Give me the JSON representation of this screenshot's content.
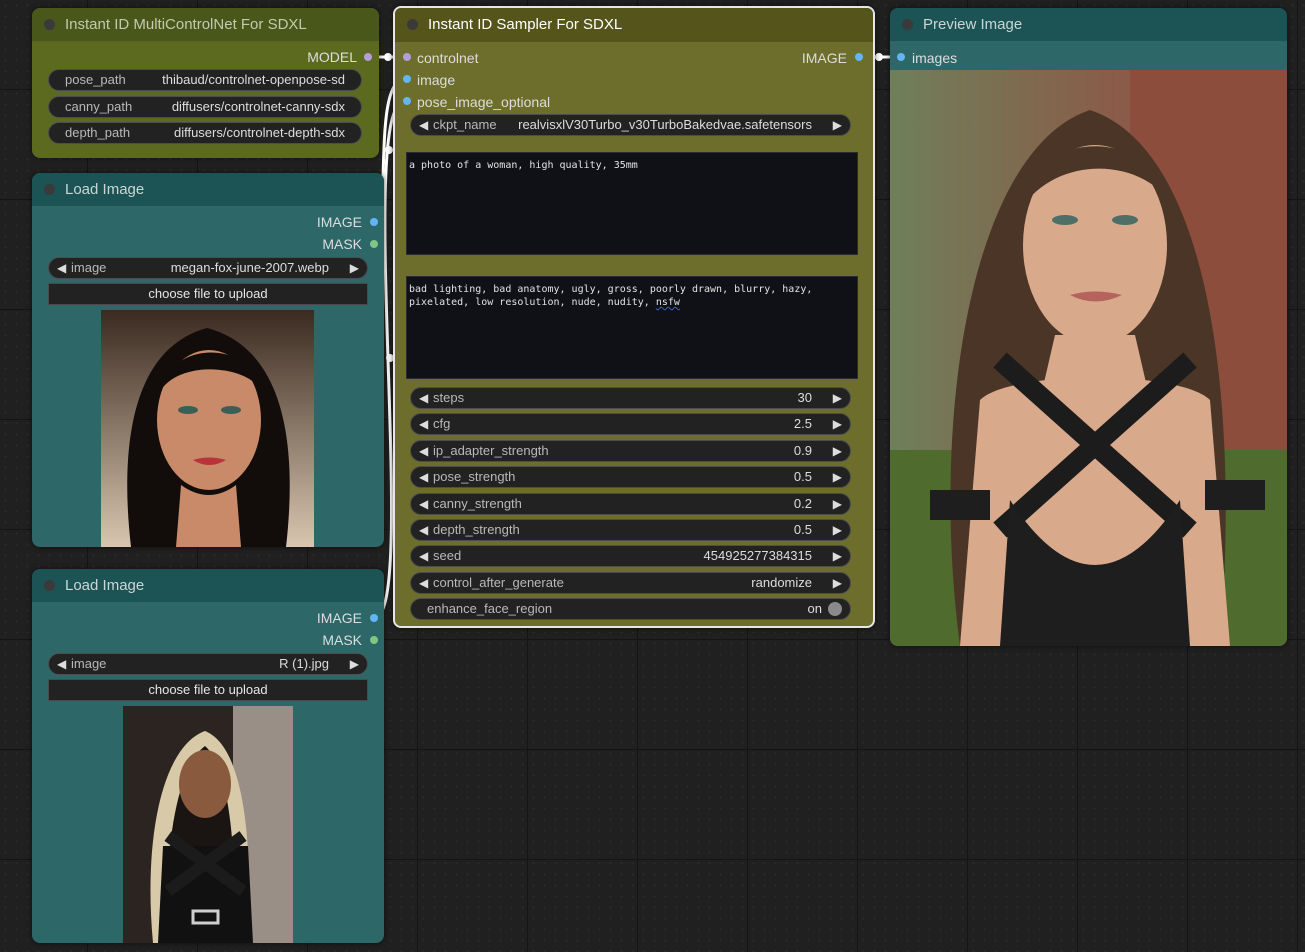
{
  "colors": {
    "canvas_bg": "#202020",
    "controlnet_node_bg": "#5c6a1f",
    "controlnet_node_title": "#4a571a",
    "sampler_node_bg": "#6d6d2c",
    "sampler_node_title": "#54541b",
    "load_image_node_bg": "#2d6768",
    "load_image_node_title": "#1c5354",
    "preview_node_bg": "#2d6768",
    "preview_node_title": "#1c5354",
    "model_slot": "#b39ddb",
    "image_slot": "#64b5f6",
    "mask_slot": "#81c784"
  },
  "controlnet_node": {
    "title": "Instant ID MultiControlNet For SDXL",
    "output_label": "MODEL",
    "widgets": [
      {
        "label": "pose_path",
        "value": "thibaud/controlnet-openpose-sd"
      },
      {
        "label": "canny_path",
        "value": "diffusers/controlnet-canny-sdx"
      },
      {
        "label": "depth_path",
        "value": "diffusers/controlnet-depth-sdx"
      }
    ]
  },
  "load_image_1": {
    "title": "Load Image",
    "outputs": [
      "IMAGE",
      "MASK"
    ],
    "image_label": "image",
    "image_value": "megan-fox-june-2007.webp",
    "upload_label": "choose file to upload",
    "preview_icon": "portrait-photo"
  },
  "load_image_2": {
    "title": "Load Image",
    "outputs": [
      "IMAGE",
      "MASK"
    ],
    "image_label": "image",
    "image_value": "R (1).jpg",
    "upload_label": "choose file to upload",
    "preview_icon": "portrait-photo"
  },
  "sampler_node": {
    "title": "Instant ID Sampler For SDXL",
    "inputs": [
      "controlnet",
      "image",
      "pose_image_optional"
    ],
    "output_label": "IMAGE",
    "ckpt_label": "ckpt_name",
    "ckpt_value": "realvisxlV30Turbo_v30TurboBakedvae.safetensors",
    "positive_prompt": "a photo of a woman, high quality, 35mm",
    "negative_prompt_main": "bad lighting, bad anatomy, ugly, gross, poorly drawn, blurry, hazy, pixelated, low resolution, nude, nudity, ",
    "negative_prompt_flagged": "nsfw",
    "widgets": [
      {
        "label": "steps",
        "value": "30"
      },
      {
        "label": "cfg",
        "value": "2.5"
      },
      {
        "label": "ip_adapter_strength",
        "value": "0.9"
      },
      {
        "label": "pose_strength",
        "value": "0.5"
      },
      {
        "label": "canny_strength",
        "value": "0.2"
      },
      {
        "label": "depth_strength",
        "value": "0.5"
      },
      {
        "label": "seed",
        "value": "454925277384315"
      },
      {
        "label": "control_after_generate",
        "value": "randomize"
      }
    ],
    "toggle": {
      "label": "enhance_face_region",
      "value": "on"
    }
  },
  "preview_node": {
    "title": "Preview Image",
    "input_label": "images",
    "preview_icon": "portrait-photo"
  }
}
